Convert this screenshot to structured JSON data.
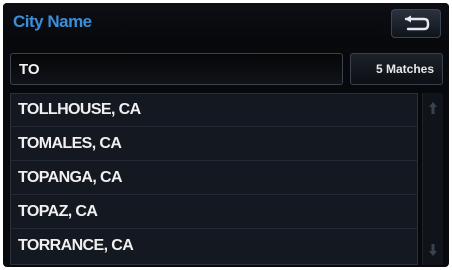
{
  "header": {
    "title": "City Name",
    "back_icon": "return-arrow-icon"
  },
  "search": {
    "value": "TO",
    "matches_label": "5 Matches"
  },
  "results": [
    "TOLLHOUSE, CA",
    "TOMALES, CA",
    "TOPANGA, CA",
    "TOPAZ, CA",
    "TORRANCE, CA"
  ],
  "scrollbar": {
    "up_icon": "scroll-up-icon",
    "down_icon": "scroll-down-icon"
  },
  "colors": {
    "title": "#3a8fd8",
    "background": "#08090d",
    "list_background": "#141820",
    "text": "#f0f0f0"
  }
}
